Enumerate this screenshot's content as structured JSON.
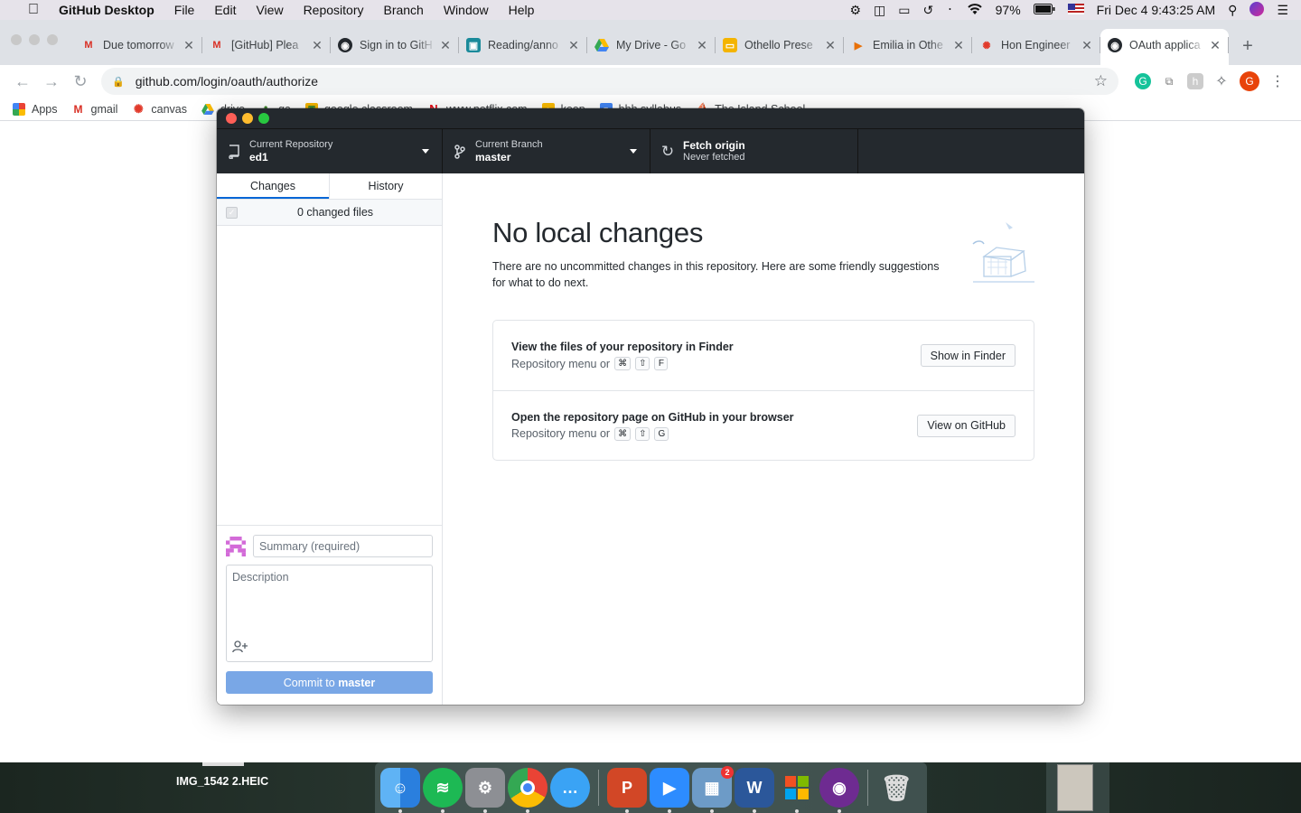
{
  "menubar": {
    "app_name": "GitHub Desktop",
    "items": [
      "File",
      "Edit",
      "View",
      "Repository",
      "Branch",
      "Window",
      "Help"
    ],
    "battery": "97%",
    "datetime": "Fri Dec 4  9:43:25 AM"
  },
  "browser": {
    "tabs": [
      {
        "title": "Due tomorrow",
        "icon": "gmail-icon"
      },
      {
        "title": "[GitHub] Plea",
        "icon": "gmail-icon"
      },
      {
        "title": "Sign in to GitH",
        "icon": "github-icon"
      },
      {
        "title": "Reading/anno",
        "icon": "classroom-icon"
      },
      {
        "title": "My Drive - Go",
        "icon": "drive-icon"
      },
      {
        "title": "Othello Prese",
        "icon": "slides-icon"
      },
      {
        "title": "Emilia in Othe",
        "icon": "video-icon"
      },
      {
        "title": "Hon Engineer",
        "icon": "canvas-icon"
      },
      {
        "title": "OAuth applica",
        "icon": "github-icon"
      }
    ],
    "url": "github.com/login/oauth/authorize",
    "bookmarks": [
      {
        "label": "Apps",
        "icon": "apps-grid-icon"
      },
      {
        "label": "gmail",
        "icon": "gmail-icon"
      },
      {
        "label": "canvas",
        "icon": "canvas-icon"
      },
      {
        "label": "drive",
        "icon": "drive-icon"
      },
      {
        "label": "ga",
        "icon": "tree-icon"
      },
      {
        "label": "google classroom",
        "icon": "classroom-icon"
      },
      {
        "label": "www.netflix.com",
        "icon": "netflix-icon"
      },
      {
        "label": "keep",
        "icon": "keep-icon"
      },
      {
        "label": "bhh syllabus",
        "icon": "docs-icon"
      },
      {
        "label": "The Island School",
        "icon": "island-icon"
      }
    ],
    "extension_avatar": "G"
  },
  "gh": {
    "repo_label": "Current Repository",
    "repo_value": "ed1",
    "branch_label": "Current Branch",
    "branch_value": "master",
    "fetch_label": "Fetch origin",
    "fetch_sub": "Never fetched",
    "tab_changes": "Changes",
    "tab_history": "History",
    "changed_files": "0 changed files",
    "summary_placeholder": "Summary (required)",
    "description_placeholder": "Description",
    "commit_prefix": "Commit to ",
    "commit_branch": "master",
    "heading": "No local changes",
    "intro": "There are no uncommitted changes in this repository. Here are some friendly suggestions for what to do next.",
    "cards": [
      {
        "title": "View the files of your repository in Finder",
        "sub": "Repository menu or",
        "keys": [
          "⌘",
          "⇧",
          "F"
        ],
        "button": "Show in Finder"
      },
      {
        "title": "Open the repository page on GitHub in your browser",
        "sub": "Repository menu or",
        "keys": [
          "⌘",
          "⇧",
          "G"
        ],
        "button": "View on GitHub"
      }
    ]
  },
  "desktop": {
    "file_label": "IMG_1542 2.HEIC",
    "dock_apps": [
      "Finder",
      "Spotify",
      "System Preferences",
      "Google Chrome",
      "Messages",
      "PowerPoint",
      "Zoom",
      "Preview",
      "Word",
      "Microsoft Store",
      "GitHub Desktop",
      "Trash"
    ],
    "preview_badge": "2"
  },
  "colors": {
    "toolbar_bg": "#24292e",
    "accent": "#0366d6",
    "commit_button": "#79a7e6"
  }
}
